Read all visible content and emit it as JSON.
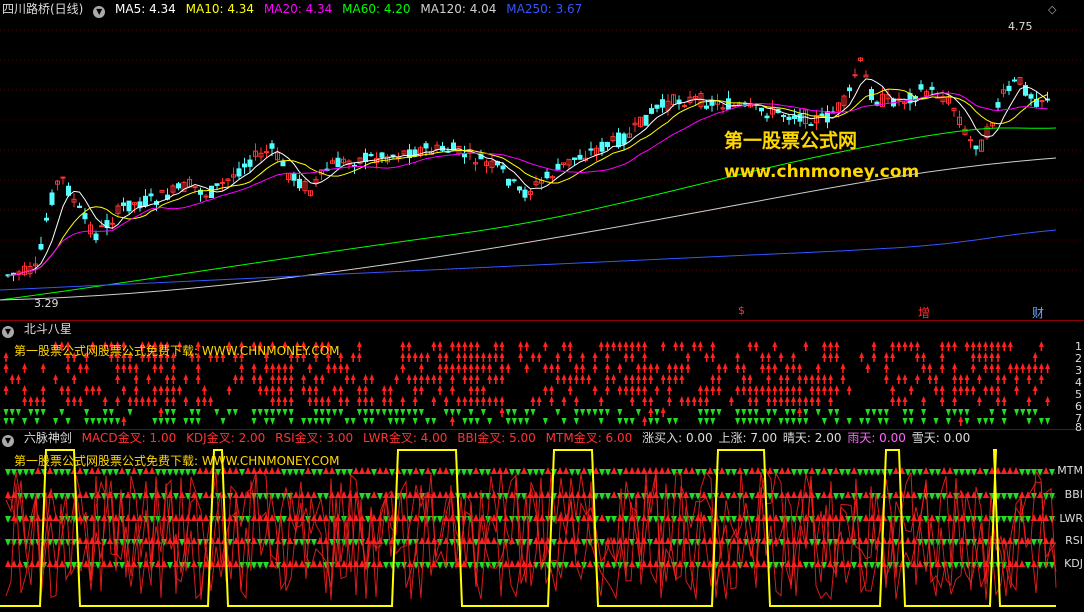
{
  "main": {
    "title": "四川路桥(日线)",
    "ma": [
      {
        "label": "MA5: 4.34",
        "color": "#ffffff"
      },
      {
        "label": "MA10: 4.34",
        "color": "#ffff00"
      },
      {
        "label": "MA20: 4.34",
        "color": "#ff00ff"
      },
      {
        "label": "MA60: 4.20",
        "color": "#00ff00"
      },
      {
        "label": "MA120: 4.04",
        "color": "#d0d0d0"
      },
      {
        "label": "MA250: 3.67",
        "color": "#3355ff"
      }
    ],
    "high_label": "4.75",
    "low_label": "3.29",
    "watermark_cn": "第一股票公式网",
    "watermark_url": "www.chnmoney.com",
    "markers": [
      {
        "text": "$",
        "color": "#ff3333"
      },
      {
        "text": "增",
        "color": "#ff3333"
      },
      {
        "text": "财",
        "color": "#66aaff"
      }
    ]
  },
  "panel2": {
    "title": "北斗八星",
    "promo": "第一股票公式网股票公式免费下载: WWW.CHNMONEY.COM",
    "row_labels": [
      "1",
      "2",
      "3",
      "4",
      "5",
      "6",
      "7",
      "8"
    ]
  },
  "panel3": {
    "title": "六脉神剑",
    "indicators": [
      {
        "label": "MACD金叉: 1.00",
        "color": "#ff3333"
      },
      {
        "label": "KDJ金叉: 2.00",
        "color": "#ff3333"
      },
      {
        "label": "RSI金叉: 3.00",
        "color": "#ff3333"
      },
      {
        "label": "LWR金叉: 4.00",
        "color": "#ff3333"
      },
      {
        "label": "BBI金叉: 5.00",
        "color": "#ff3333"
      },
      {
        "label": "MTM金叉: 6.00",
        "color": "#ff3333"
      },
      {
        "label": "涨买入: 0.00",
        "color": "#dddddd"
      },
      {
        "label": "上涨: 7.00",
        "color": "#dddddd"
      },
      {
        "label": "晴天: 2.00",
        "color": "#dddddd"
      },
      {
        "label": "雨天: 0.00",
        "color": "#ff66ff"
      },
      {
        "label": "雪天: 0.00",
        "color": "#dddddd"
      }
    ],
    "promo": "第一股票公式网股票公式免费下载: WWW.CHNMONEY.COM",
    "row_labels": [
      "MTM",
      "BBI",
      "LWR",
      "RSI",
      "KDJ"
    ]
  },
  "colors": {
    "up": "#ff3333",
    "down": "#54ffff",
    "arrow_up": "#ff2020",
    "arrow_down": "#22dd22",
    "signal": "#ffff00"
  }
}
